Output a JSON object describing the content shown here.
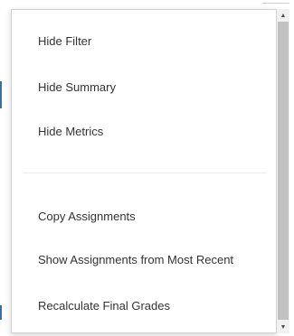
{
  "menu": {
    "group_view": [
      {
        "label": "Hide Filter"
      },
      {
        "label": "Hide Summary"
      },
      {
        "label": "Hide Metrics"
      }
    ],
    "group_actions": [
      {
        "label": "Copy Assignments"
      },
      {
        "label": "Show Assignments from Most Recent"
      },
      {
        "label": "Recalculate Final Grades"
      }
    ]
  },
  "scrollbar": {
    "up_icon": "triangle-up",
    "down_icon": "triangle-down"
  }
}
